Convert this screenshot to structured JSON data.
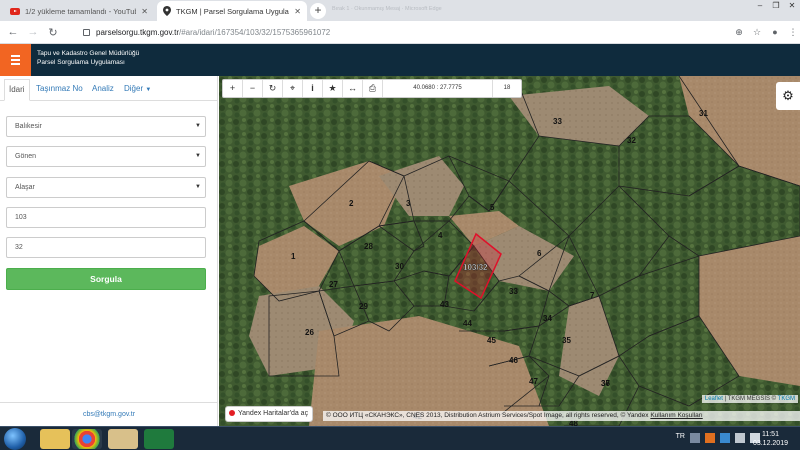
{
  "browser": {
    "tabs": [
      {
        "title": "1/2 yükleme tamamlandı - YouTube",
        "icon": "youtube-icon"
      },
      {
        "title": "TKGM | Parsel Sorgulama Uygulaması",
        "icon": "map-pin-icon"
      }
    ],
    "ghost_title": "Bırak 1 · Okunmamış Mesaj · Microsoft Edge",
    "url_host": "parselsorgu.tkgm.gov.tr",
    "url_path": "/#ara/idari/167354/103/32/1575365961072"
  },
  "app": {
    "title_line1": "Tapu ve Kadastro Genel Müdürlüğü",
    "title_line2": "Parsel Sorgulama Uygulaması"
  },
  "panel": {
    "tabs": [
      "İdari",
      "Taşınmaz No",
      "Analiz",
      "Diğer"
    ],
    "active_tab": "İdari",
    "il": "Balıkesir",
    "ilce": "Gönen",
    "mahalle": "Alaşar",
    "ada": "103",
    "parsel": "32",
    "search_label": "Sorgula",
    "footer_email": "cbs@tkgm.gov.tr"
  },
  "map": {
    "coords": "40.0680 : 27.7775",
    "zoom": "18",
    "selected_label": "103/32",
    "yandex_link": "Yandex Haritalar'da aç",
    "leaflet_attr_link": "Leaflet",
    "leaflet_attr_text": "| TKGM MEGSİS ©",
    "leaflet_attr_tkgm": "TKGM",
    "yandex_attr_text": "© ООО ИТЦ «СКАНЭКС», CNES 2013, Distribution Astrium Services/Spot Image, all rights reserved, © Yandex",
    "yandex_attr_link": "Kullanım Koşulları",
    "parcels": [
      "1",
      "2",
      "3",
      "4",
      "5",
      "6",
      "7",
      "26",
      "27",
      "28",
      "29",
      "30",
      "31",
      "32",
      "33",
      "33",
      "34",
      "35",
      "36",
      "37",
      "42",
      "43",
      "44",
      "45",
      "46",
      "47",
      "48"
    ]
  },
  "taskbar": {
    "lang": "TR",
    "time": "11:51",
    "date": "03.12.2019"
  }
}
